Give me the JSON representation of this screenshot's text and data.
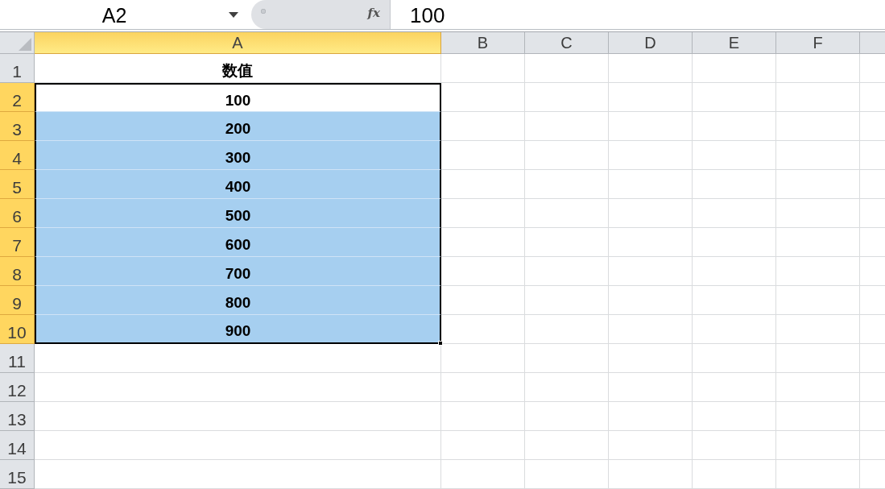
{
  "formula_bar": {
    "name_box": "A2",
    "fx": "fx",
    "formula": "100"
  },
  "columns": [
    {
      "label": "A",
      "selected": true
    },
    {
      "label": "B",
      "selected": false
    },
    {
      "label": "C",
      "selected": false
    },
    {
      "label": "D",
      "selected": false
    },
    {
      "label": "E",
      "selected": false
    },
    {
      "label": "F",
      "selected": false
    }
  ],
  "rows": [
    {
      "header": "1",
      "selected": false,
      "active": false,
      "value": "数值"
    },
    {
      "header": "2",
      "selected": true,
      "active": true,
      "value": "100"
    },
    {
      "header": "3",
      "selected": true,
      "active": false,
      "value": "200"
    },
    {
      "header": "4",
      "selected": true,
      "active": false,
      "value": "300"
    },
    {
      "header": "5",
      "selected": true,
      "active": false,
      "value": "400"
    },
    {
      "header": "6",
      "selected": true,
      "active": false,
      "value": "500"
    },
    {
      "header": "7",
      "selected": true,
      "active": false,
      "value": "600"
    },
    {
      "header": "8",
      "selected": true,
      "active": false,
      "value": "700"
    },
    {
      "header": "9",
      "selected": true,
      "active": false,
      "value": "800"
    },
    {
      "header": "10",
      "selected": true,
      "active": false,
      "value": "900"
    },
    {
      "header": "11",
      "selected": false,
      "active": false
    },
    {
      "header": "12",
      "selected": false,
      "active": false
    },
    {
      "header": "13",
      "selected": false,
      "active": false
    },
    {
      "header": "14",
      "selected": false,
      "active": false
    },
    {
      "header": "15",
      "selected": false,
      "active": false
    }
  ]
}
